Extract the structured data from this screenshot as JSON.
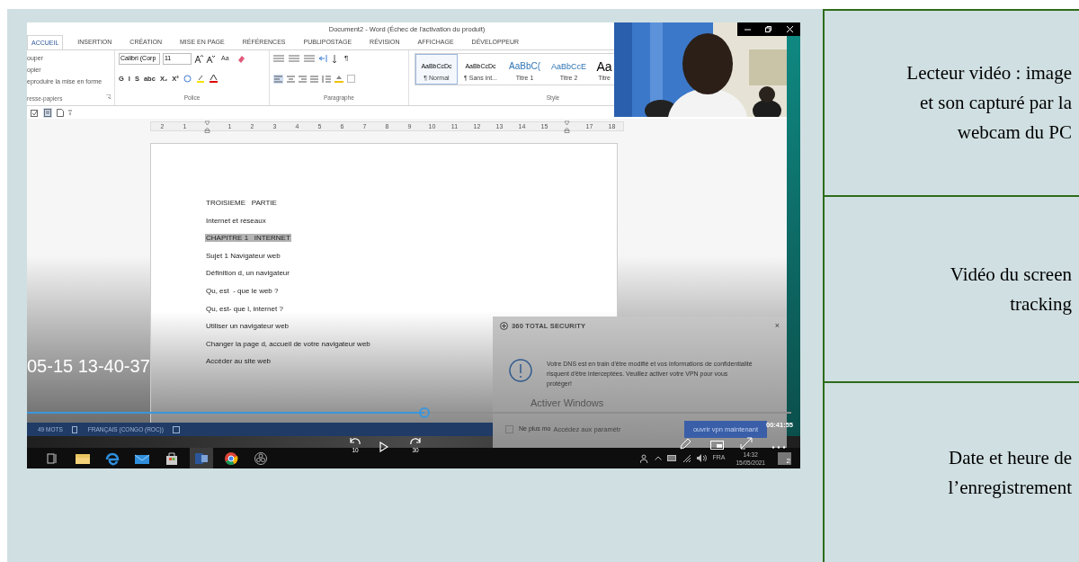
{
  "video_player": {
    "recording": {
      "word": {
        "title": "Document2 - Word (Échec de l'activation du produit)",
        "tabs": [
          {
            "label": "ACCUEIL",
            "selected": true
          },
          {
            "label": "INSERTION",
            "selected": false
          },
          {
            "label": "CRÉATION",
            "selected": false
          },
          {
            "label": "MISE EN PAGE",
            "selected": false
          },
          {
            "label": "RÉFÉRENCES",
            "selected": false
          },
          {
            "label": "PUBLIPOSTAGE",
            "selected": false
          },
          {
            "label": "RÉVISION",
            "selected": false
          },
          {
            "label": "AFFICHAGE",
            "selected": false
          },
          {
            "label": "DÉVELOPPEUR",
            "selected": false
          }
        ],
        "clipboard": {
          "items": [
            "ouper",
            "opier",
            "eproduire la mise en forme"
          ],
          "group": "resse-papiers"
        },
        "font": {
          "name": "Calibri (Corp",
          "size": "11",
          "case_button": "Aa",
          "format_keys": [
            "G",
            "I",
            "S",
            "abc",
            "X₂",
            "X²"
          ],
          "group": "Police"
        },
        "paragraph": {
          "mark": "¶",
          "group": "Paragraphe"
        },
        "styles": {
          "items": [
            {
              "sample": "AaBbCcDc",
              "name": "¶ Normal",
              "kind": "normal",
              "selected": true
            },
            {
              "sample": "AaBbCcDc",
              "name": "¶ Sans int...",
              "kind": "normal",
              "selected": false
            },
            {
              "sample": "AaBbC(",
              "name": "Titre 1",
              "kind": "heading1",
              "selected": false
            },
            {
              "sample": "AaBbCcE",
              "name": "Titre 2",
              "kind": "heading2",
              "selected": false
            },
            {
              "sample": "Aa",
              "name": "Titre",
              "kind": "title",
              "selected": false
            }
          ],
          "group": "Style"
        },
        "ruler": [
          {
            "kind": "number",
            "label": "2"
          },
          {
            "kind": "number",
            "label": "1"
          },
          {
            "kind": "marker"
          },
          {
            "kind": "number",
            "label": "1"
          },
          {
            "kind": "number",
            "label": "2"
          },
          {
            "kind": "number",
            "label": "3"
          },
          {
            "kind": "number",
            "label": "4"
          },
          {
            "kind": "number",
            "label": "5"
          },
          {
            "kind": "number",
            "label": "6"
          },
          {
            "kind": "number",
            "label": "7"
          },
          {
            "kind": "number",
            "label": "8"
          },
          {
            "kind": "number",
            "label": "9"
          },
          {
            "kind": "number",
            "label": "10"
          },
          {
            "kind": "number",
            "label": "11"
          },
          {
            "kind": "number",
            "label": "12"
          },
          {
            "kind": "number",
            "label": "13"
          },
          {
            "kind": "number",
            "label": "14"
          },
          {
            "kind": "number",
            "label": "15"
          },
          {
            "kind": "marker"
          },
          {
            "kind": "number",
            "label": "17"
          },
          {
            "kind": "number",
            "label": "18"
          }
        ],
        "lines": [
          {
            "text": "TROISIEME   PARTIE",
            "selected": false
          },
          {
            "text": "Internet et réseaux",
            "selected": false
          },
          {
            "text": "CHAPITRE 1   INTERNET",
            "selected": true
          },
          {
            "text": "Sujet 1 Navigateur web",
            "selected": false
          },
          {
            "text": "Définition d, un navigateur",
            "selected": false
          },
          {
            "text": "Qu, est  - que le web ?",
            "selected": false
          },
          {
            "text": "Qu, est- que l, internet ?",
            "selected": false
          },
          {
            "text": "Utiliser un navigateur web",
            "selected": false
          },
          {
            "text": "Changer la page d, accueil de votre navigateur web",
            "selected": false
          },
          {
            "text": "Accéder au site web",
            "selected": false
          }
        ],
        "status": {
          "words": "49 MOTS",
          "language": "FRANÇAIS (CONGO (ROC))"
        }
      },
      "notification": {
        "title": "360 TOTAL SECURITY",
        "close": "×",
        "message": "Votre DNS est en train d'être modifié et vos informations de confidentialité risquent d'être interceptées. Veuillez activer votre VPN pour vous protéger!",
        "checkbox": {
          "label": "Ne plus mo",
          "checked": false
        },
        "button": "ouvrir vpn maintenant"
      },
      "activation_notice": {
        "title": "Activer Windows",
        "subtitle": "Accédez aux paramètr"
      },
      "taskbar": {
        "apps": [
          {
            "kind": "task-view",
            "selected": false
          },
          {
            "kind": "folder",
            "selected": false
          },
          {
            "kind": "edge",
            "selected": false
          },
          {
            "kind": "mail",
            "selected": false
          },
          {
            "kind": "store",
            "selected": false
          },
          {
            "kind": "word",
            "selected": true
          },
          {
            "kind": "chrome",
            "selected": false
          },
          {
            "kind": "obs",
            "selected": false
          }
        ],
        "language": "FRA",
        "time": "14:32",
        "date": "15/05/2021",
        "notifications": "2"
      }
    },
    "timestamp": "05-15 13-40-37",
    "progress": {
      "level": 0.52
    },
    "elapsed": "00:41:55",
    "rewind_label": "10",
    "forward_label": "30"
  },
  "captions": [
    "Lecteur vidéo : image et son capturé par la webcam du PC",
    "Vidéo du screen tracking",
    "Date et heure de l’enregistrement"
  ]
}
